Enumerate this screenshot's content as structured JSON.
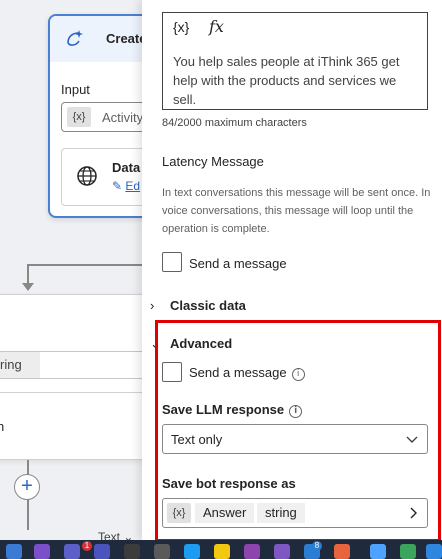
{
  "canvas": {
    "node_title": "Create",
    "input_label": "Input",
    "input_chip": "{x}",
    "input_value": "Activity",
    "data_label": "Data",
    "data_edit": "Ed",
    "string_chip": "ring",
    "node_line": "n",
    "bottom_text": "Text"
  },
  "panel": {
    "editor": {
      "tool_variable": "{x}",
      "tool_formula": "fx",
      "text": "You help sales people at iThink 365 get help with the products and services we sell."
    },
    "char_count": "84/2000 maximum characters",
    "latency": {
      "title": "Latency Message",
      "description": "In text conversations this message will be sent once. In voice conversations, this message will loop until the operation is complete.",
      "checkbox_label": "Send a message"
    },
    "classic": {
      "chevron": "›",
      "label": "Classic data"
    },
    "advanced": {
      "chevron": "⌄",
      "label": "Advanced",
      "checkbox_label": "Send a message",
      "llm_title": "Save LLM response",
      "llm_value": "Text only",
      "bot_title": "Save bot response as",
      "var_chip": "{x}",
      "var_name": "Answer",
      "var_type": "string"
    }
  },
  "taskbar": {
    "badge_teams": "1",
    "badge_other": "8"
  },
  "colors": {
    "accent": "#2b64c4",
    "highlight_border": "#e00000",
    "taskbar_bg": "#1f2a3c"
  }
}
